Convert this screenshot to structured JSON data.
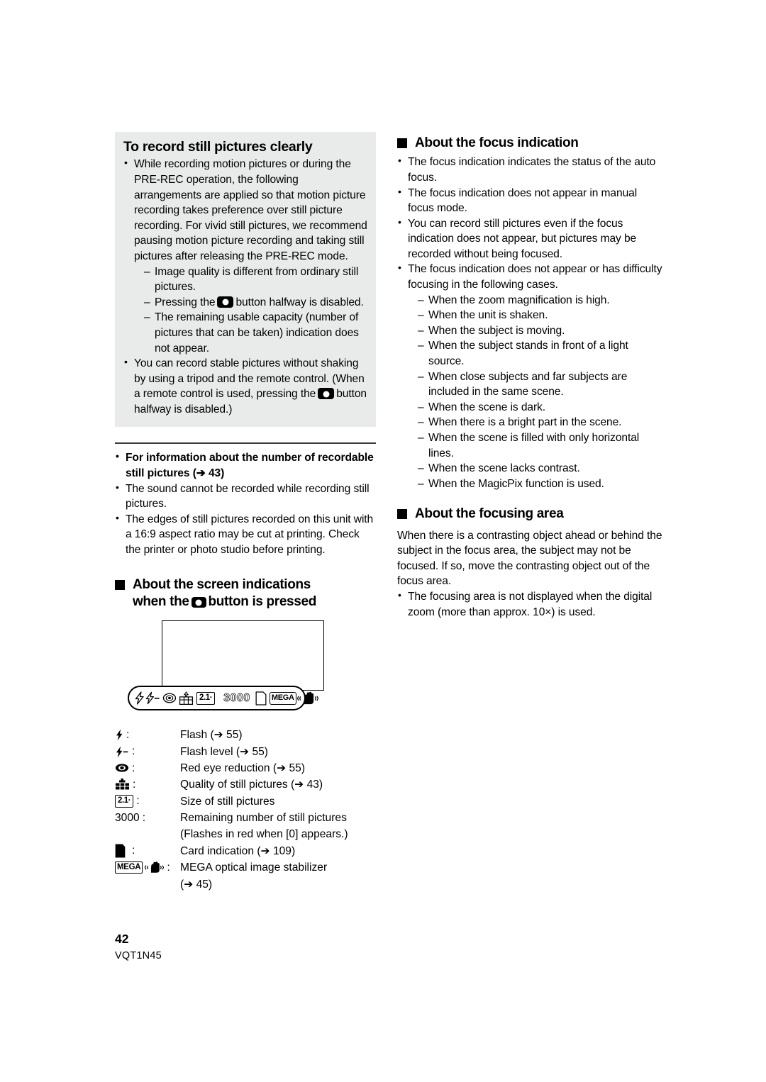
{
  "page": {
    "number": "42",
    "code": "VQT1N45"
  },
  "left_column": {
    "gray_box": {
      "title": "To record still pictures clearly",
      "bullets": [
        {
          "text": "While recording motion pictures or during the PRE-REC operation, the following arrangements are applied so that motion picture recording takes preference over still picture recording. For vivid still pictures, we recommend pausing motion picture recording and taking still pictures after releasing the PRE-REC mode.",
          "sub": [
            {
              "pre": "Image quality is different from ordinary still pictures.",
              "icon": null,
              "post": ""
            },
            {
              "pre": "Pressing the",
              "icon": "photo-button-icon",
              "post": "button halfway is disabled."
            },
            {
              "pre": "The remaining usable capacity (number of pictures that can be taken) indication does not appear.",
              "icon": null,
              "post": ""
            }
          ]
        },
        {
          "pre": "You can record stable pictures without shaking by using a tripod and the remote control. (When a remote control is used, pressing the",
          "icon": "photo-button-icon",
          "post": "button halfway is disabled.)"
        }
      ]
    },
    "notes": [
      {
        "bold": true,
        "text": "For information about the number of recordable still pictures (➔ 43)"
      },
      {
        "bold": false,
        "text": "The sound cannot be recorded while recording still pictures."
      },
      {
        "bold": false,
        "text": "The edges of still pictures recorded on this unit with a 16:9 aspect ratio may be cut at printing. Check the printer or photo studio before printing."
      }
    ],
    "screen_indications": {
      "heading_line1": "About the screen indications",
      "heading_line2_pre": "when the",
      "heading_line2_icon": "photo-button-icon",
      "heading_line2_post": "button is pressed",
      "figure": {
        "strip_icons": [
          "flash-icon",
          "flash-level-icon",
          "red-eye-reduction-icon",
          "still-picture-quality-icon",
          "still-picture-size-icon",
          "remaining-pictures-count",
          "card-indication-icon",
          "mega-ois-icon"
        ],
        "size_value": "2.1",
        "count_value": "3000",
        "mega_label": "MEGA"
      },
      "legend": [
        {
          "symbol": "flash-icon",
          "sym_text": "",
          "definition": "Flash (➔ 55)"
        },
        {
          "symbol": "flash-level-icon",
          "sym_text": "",
          "definition": "Flash level (➔ 55)"
        },
        {
          "symbol": "red-eye-reduction-icon",
          "sym_text": "",
          "definition": "Red eye reduction (➔ 55)"
        },
        {
          "symbol": "still-picture-quality-icon",
          "sym_text": "",
          "definition": "Quality of still pictures (➔ 43)"
        },
        {
          "symbol": "still-picture-size-icon",
          "sym_text": "2.1",
          "definition": "Size of still pictures"
        },
        {
          "symbol": "remaining-count-text",
          "sym_text": "3000",
          "definition": "Remaining number of still pictures",
          "continuation": "(Flashes in red when [0] appears.)"
        },
        {
          "symbol": "card-indication-icon",
          "sym_text": "",
          "definition": "Card indication (➔ 109)"
        },
        {
          "symbol": "mega-ois-icon",
          "sym_text": "MEGA",
          "definition": "MEGA optical image stabilizer",
          "continuation": "(➔ 45)"
        }
      ]
    }
  },
  "right_column": {
    "focus_indication": {
      "heading": "About the focus indication",
      "bullets": [
        {
          "text": "The focus indication indicates the status of the auto focus."
        },
        {
          "text": "The focus indication does not appear in manual focus mode."
        },
        {
          "text": "You can record still pictures even if the focus indication does not appear, but pictures may be recorded without being focused."
        },
        {
          "text": "The focus indication does not appear or has difficulty focusing in the following cases.",
          "sub": [
            "When the zoom magnification is high.",
            "When the unit is shaken.",
            "When the subject is moving.",
            "When the subject stands in front of a light source.",
            "When close subjects and far subjects are included in the same scene.",
            "When the scene is dark.",
            "When there is a bright part in the scene.",
            "When the scene is filled with only horizontal lines.",
            "When the scene lacks contrast.",
            "When the MagicPix function is used."
          ]
        }
      ]
    },
    "focusing_area": {
      "heading": "About the focusing area",
      "paragraph": "When there is a contrasting object ahead or behind the subject in the focus area, the subject may not be focused. If so, move the contrasting object out of the focus area.",
      "bullets": [
        {
          "text": "The focusing area is not displayed when the digital zoom (more than approx. 10×) is used."
        }
      ]
    }
  }
}
